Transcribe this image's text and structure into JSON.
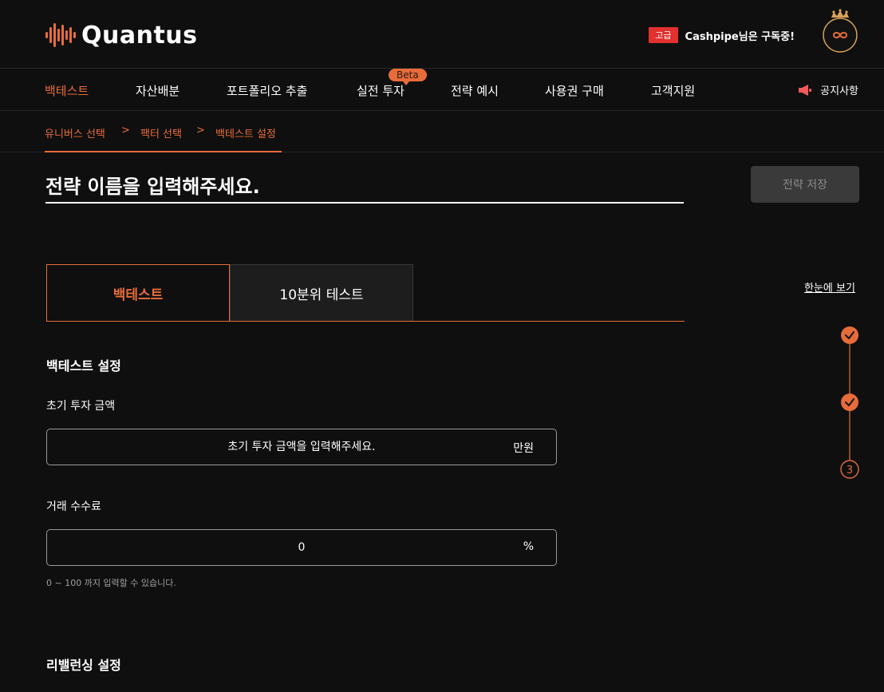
{
  "brand": {
    "name": "Quantus",
    "accent": "#e86c3a"
  },
  "header": {
    "tier_badge": "고급",
    "subscription_text": "Cashpipe님은 구독중!"
  },
  "nav": {
    "items": [
      {
        "label": "백테스트",
        "active": true
      },
      {
        "label": "자산배분"
      },
      {
        "label": "포트폴리오 추출"
      },
      {
        "label": "실전 투자",
        "badge": "Beta"
      },
      {
        "label": "전략 예시"
      },
      {
        "label": "사용권 구매"
      },
      {
        "label": "고객지원"
      }
    ],
    "notice_label": "공지사항"
  },
  "breadcrumb": {
    "items": [
      "유니버스 선택",
      "팩터 선택",
      "백테스트 설정"
    ],
    "separator": ">"
  },
  "strategy": {
    "name_placeholder": "전략 이름을 입력해주세요.",
    "save_label": "전략 저장"
  },
  "tabs": [
    {
      "label": "백테스트",
      "active": true
    },
    {
      "label": "10분위 테스트"
    }
  ],
  "backtest_settings": {
    "title": "백테스트 설정",
    "initial_amount": {
      "label": "초기 투자 금액",
      "placeholder": "초기 투자 금액을 입력해주세요.",
      "unit": "만원"
    },
    "fee": {
      "label": "거래 수수료",
      "value": "0",
      "unit": "%",
      "hint": "0 ~ 100 까지 입력할 수 있습니다."
    }
  },
  "rebalancing": {
    "title": "리밸런싱 설정"
  },
  "sidebar": {
    "overview_label": "한눈에 보기",
    "steps": [
      {
        "state": "done"
      },
      {
        "state": "done"
      },
      {
        "state": "current",
        "label": "3"
      }
    ]
  }
}
